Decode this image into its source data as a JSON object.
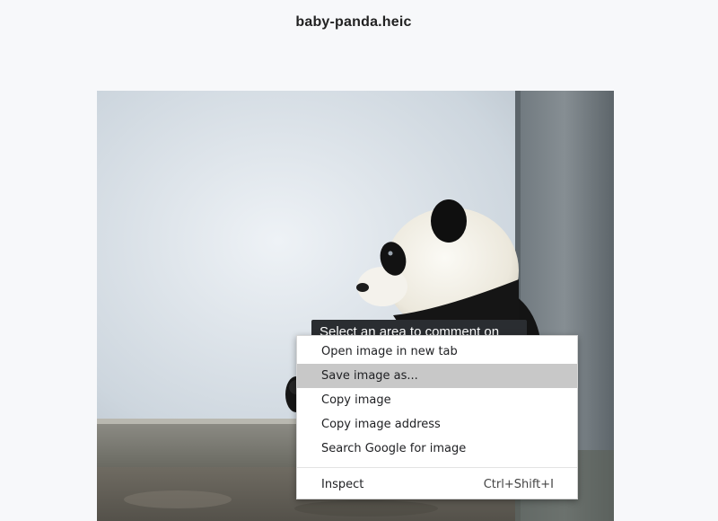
{
  "page": {
    "title": "baby-panda.heic"
  },
  "image": {
    "subject": "panda-photo"
  },
  "tooltip": {
    "text": "Select an area to comment on"
  },
  "context_menu": {
    "items": [
      {
        "label": "Open image in new tab",
        "highlighted": false
      },
      {
        "label": "Save image as...",
        "highlighted": true
      },
      {
        "label": "Copy image",
        "highlighted": false
      },
      {
        "label": "Copy image address",
        "highlighted": false
      },
      {
        "label": "Search Google for image",
        "highlighted": false
      }
    ],
    "inspect": {
      "label": "Inspect",
      "shortcut": "Ctrl+Shift+I"
    }
  },
  "colors": {
    "page_bg": "#f7f8fa",
    "menu_highlight": "#c8c8c8",
    "tooltip_bg": "#2a2d31"
  }
}
